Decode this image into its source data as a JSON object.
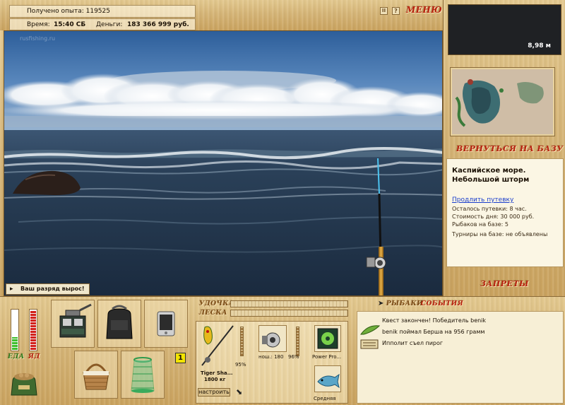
{
  "stats": {
    "exp_label": "Получено опыта:",
    "exp_value": "119525",
    "time_label": "Время:",
    "time_value": "15:40 СБ",
    "money_label": "Деньги:",
    "money_value": "183 366 999 руб."
  },
  "menu": {
    "pause_glyph": "II",
    "help_glyph": "?",
    "menu_label": "МЕНЮ"
  },
  "depth": {
    "value": "8,98 м"
  },
  "watermark": "rusfishing.ru",
  "notification": "Ваш разряд вырос!",
  "location": {
    "return_label": "ВЕРНУТЬСЯ НА БАЗУ",
    "title_line1": "Каспийское море.",
    "title_line2": "Небольшой шторм",
    "extend_link": "Продлить путевку",
    "details": [
      "Осталось путевки: 8 час.",
      "Стоимость дня: 30 000 руб.",
      "Рыбаков на базе: 5",
      "Турниры на базе: не объявлены"
    ],
    "bans_label": "ЗАПРЕТЫ"
  },
  "needs": {
    "food_label": "ЕДА",
    "alcohol_label": "ЯД",
    "food_level": 0.32,
    "alcohol_level": 1.0
  },
  "tackle": {
    "rod_label": "УДОЧКА",
    "line_label": "ЛЕСКА",
    "rod_name": "Tiger Sha...",
    "rod_weight": "1800 кг",
    "rod_percent": "95%",
    "reel_label": "нош.: 180",
    "reel_percent": "96%",
    "line_name": "Power Pro...",
    "bait_name": "Средняя",
    "configure_label": "настроить",
    "slot_number": "1"
  },
  "events": {
    "tab_fishers": "РЫБАКИ",
    "tab_events": "СОБЫТИЯ",
    "items": [
      "Квест закончен! Победитель benik",
      "benik поймал Берша на 956 грамм",
      "Ипполит съел пирог"
    ]
  },
  "colors": {
    "accent_red": "#b8230f",
    "wood": "#d6b577",
    "food_bar": "#3fbf2e",
    "alcohol_bar": "#d3221c"
  }
}
